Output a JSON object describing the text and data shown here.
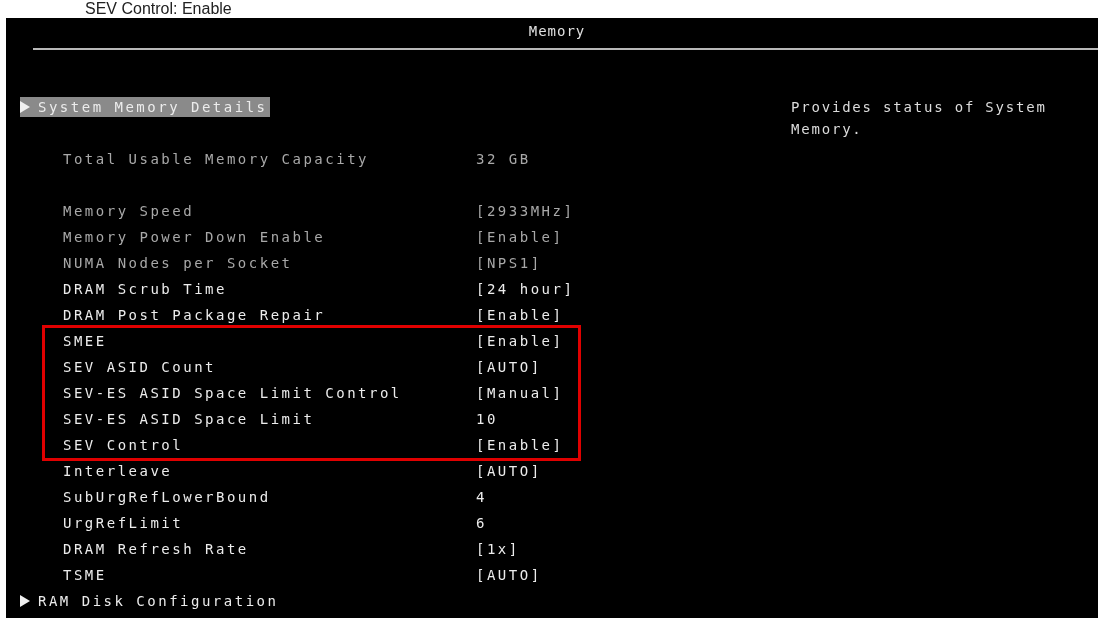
{
  "caption": "SEV Control: Enable",
  "title": "Memory",
  "sections": [
    [
      {
        "kind": "submenu",
        "label": "System Memory Details",
        "selected": true
      }
    ],
    [
      {
        "kind": "info",
        "label": "Total Usable Memory Capacity",
        "value": "32 GB",
        "selected": false,
        "disabled": true
      }
    ],
    [
      {
        "kind": "setting",
        "label": "Memory Speed",
        "value": "[2933MHz]",
        "selected": false,
        "disabled": true
      },
      {
        "kind": "setting",
        "label": "Memory Power Down Enable",
        "value": "[Enable]",
        "selected": false,
        "disabled": true
      },
      {
        "kind": "setting",
        "label": "NUMA Nodes per Socket",
        "value": "[NPS1]",
        "selected": false,
        "disabled": true
      },
      {
        "kind": "setting",
        "label": "DRAM Scrub Time",
        "value": "[24 hour]",
        "selected": false,
        "disabled": false
      },
      {
        "kind": "setting",
        "label": "DRAM Post Package Repair",
        "value": "[Enable]",
        "selected": false,
        "disabled": false
      },
      {
        "kind": "frame",
        "rows": [
          {
            "kind": "setting",
            "label": "SMEE",
            "value": "[Enable]",
            "selected": false,
            "disabled": false
          },
          {
            "kind": "setting",
            "label": "SEV ASID Count",
            "value": "[AUTO]",
            "selected": false,
            "disabled": false
          },
          {
            "kind": "setting",
            "label": "SEV-ES ASID Space Limit Control",
            "value": "[Manual]",
            "selected": false,
            "disabled": false
          },
          {
            "kind": "setting",
            "label": "SEV-ES ASID Space Limit",
            "value": "10",
            "selected": false,
            "disabled": false
          },
          {
            "kind": "setting",
            "label": "SEV Control",
            "value": "[Enable]",
            "selected": false,
            "disabled": false
          }
        ]
      },
      {
        "kind": "setting",
        "label": "Interleave",
        "value": "[AUTO]",
        "selected": false,
        "disabled": false
      },
      {
        "kind": "setting",
        "label": "SubUrgRefLowerBound",
        "value": "4",
        "selected": false,
        "disabled": false
      },
      {
        "kind": "setting",
        "label": "UrgRefLimit",
        "value": "6",
        "selected": false,
        "disabled": false
      },
      {
        "kind": "setting",
        "label": "DRAM Refresh Rate",
        "value": "[1x]",
        "selected": false,
        "disabled": false
      },
      {
        "kind": "setting",
        "label": "TSME",
        "value": "[AUTO]",
        "selected": false,
        "disabled": false
      },
      {
        "kind": "submenu",
        "label": "RAM Disk Configuration",
        "selected": false
      }
    ]
  ],
  "help": "Provides status of System Memory."
}
